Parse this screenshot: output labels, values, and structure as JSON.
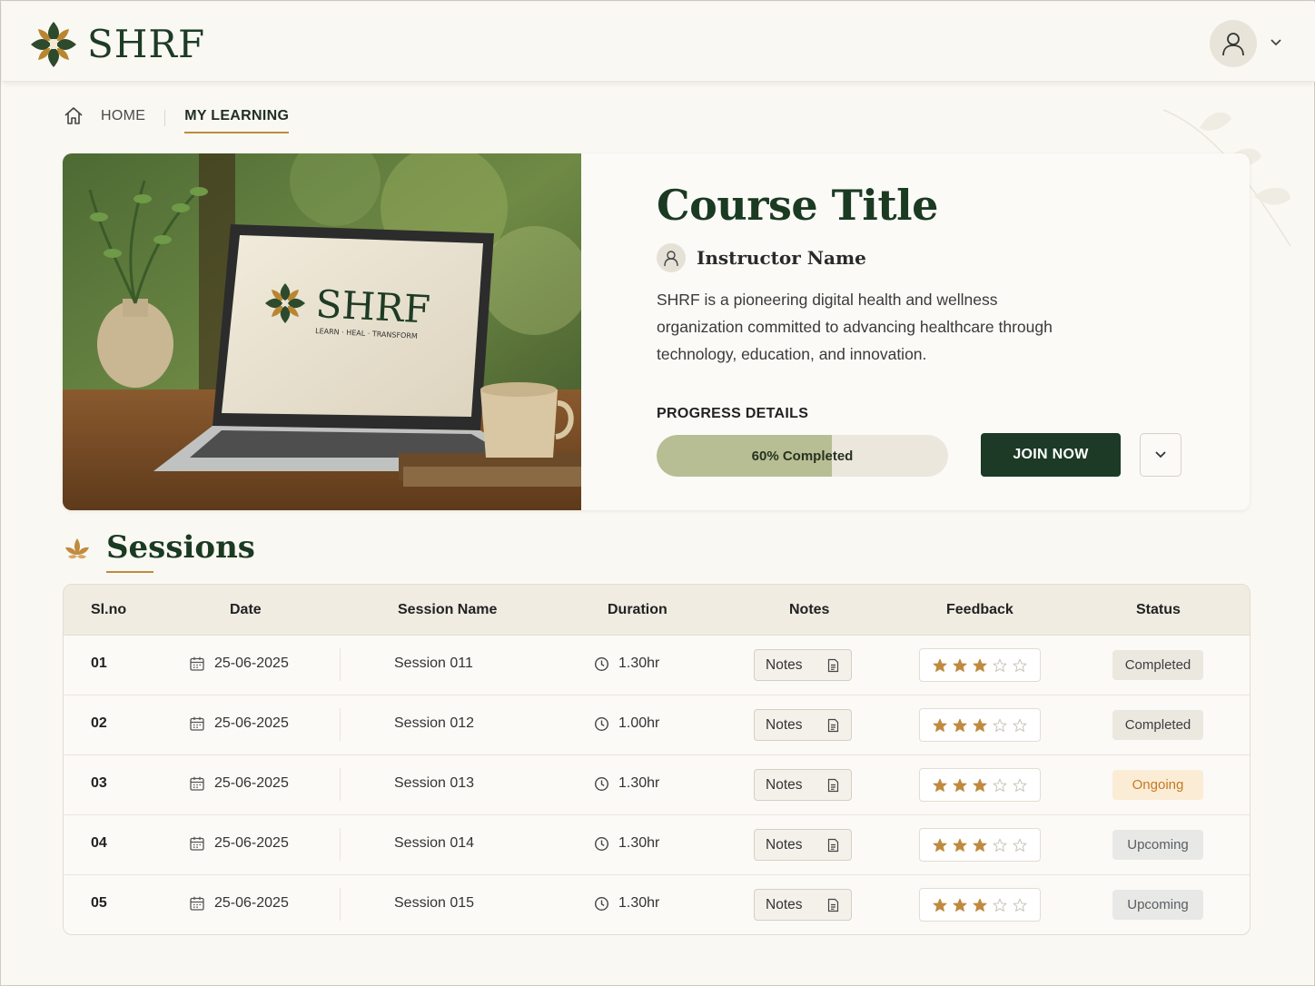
{
  "brand": {
    "name": "SHRF"
  },
  "breadcrumb": {
    "home": "HOME",
    "current": "MY LEARNING"
  },
  "course": {
    "title": "Course Title",
    "instructor": "Instructor Name",
    "description": "SHRF is a pioneering digital health and wellness organization committed to advancing healthcare through technology, education, and innovation.",
    "image_alt": "SHRF laptop on wooden desk",
    "progress_label": "PROGRESS DETAILS",
    "progress_percent": 60,
    "progress_text": "60% Completed",
    "join_label": "JOIN NOW"
  },
  "sessions": {
    "title": "Sessions",
    "columns": [
      "Sl.no",
      "Date",
      "Session Name",
      "Duration",
      "Notes",
      "Feedback",
      "Status"
    ],
    "rows": [
      {
        "no": "01",
        "date": "25-06-2025",
        "name": "Session 011",
        "duration": "1.30hr",
        "notes": "Notes",
        "rating": 3,
        "status": "Completed"
      },
      {
        "no": "02",
        "date": "25-06-2025",
        "name": "Session 012",
        "duration": "1.00hr",
        "notes": "Notes",
        "rating": 3,
        "status": "Completed"
      },
      {
        "no": "03",
        "date": "25-06-2025",
        "name": "Session 013",
        "duration": "1.30hr",
        "notes": "Notes",
        "rating": 3,
        "status": "Ongoing"
      },
      {
        "no": "04",
        "date": "25-06-2025",
        "name": "Session 014",
        "duration": "1.30hr",
        "notes": "Notes",
        "rating": 3,
        "status": "Upcoming"
      },
      {
        "no": "05",
        "date": "25-06-2025",
        "name": "Session 015",
        "duration": "1.30hr",
        "notes": "Notes",
        "rating": 3,
        "status": "Upcoming"
      }
    ]
  },
  "colors": {
    "brand_green": "#1c3a25",
    "accent_gold": "#c08a3e",
    "progress_fill": "#b8be94",
    "status_ongoing": "#c47a22"
  },
  "icons": [
    "logo-flower-icon",
    "user-icon",
    "chevron-down-icon",
    "home-icon",
    "calendar-icon",
    "clock-icon",
    "document-icon",
    "star-icon"
  ]
}
